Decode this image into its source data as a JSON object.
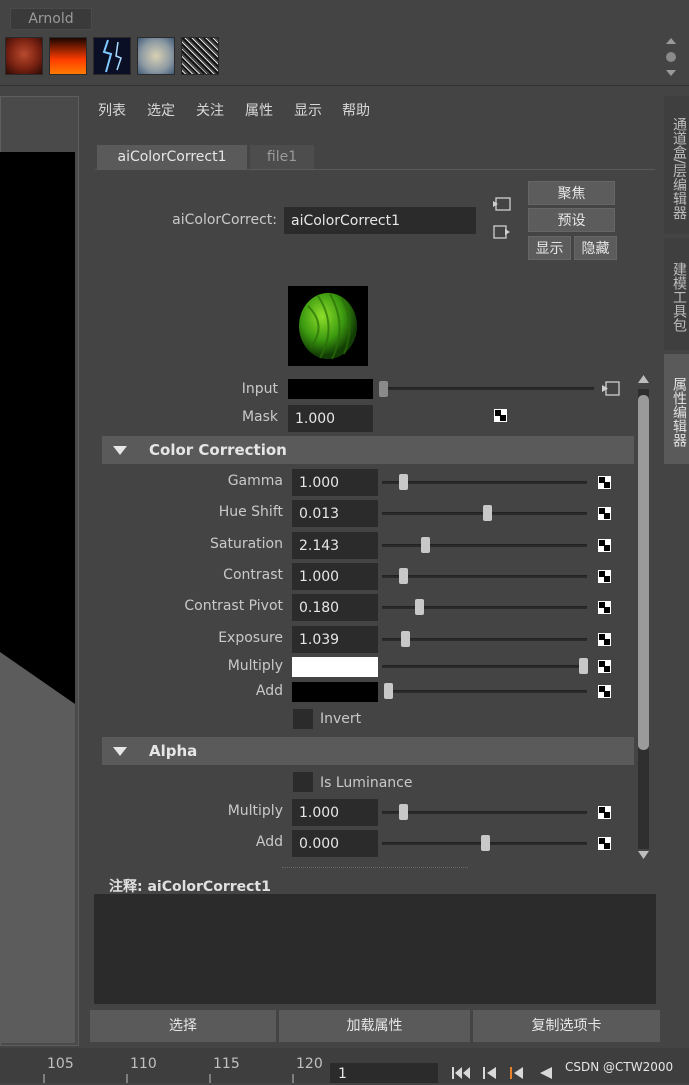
{
  "shelf": {
    "tab": "Arnold",
    "icons": [
      "texture-icon",
      "fire-icon",
      "lightning-icon",
      "cloud-icon",
      "noise-icon"
    ]
  },
  "side_tabs": [
    "通道盒/层编辑器",
    "建模工具包",
    "属性编辑器"
  ],
  "menu": [
    "列表",
    "选定",
    "关注",
    "属性",
    "显示",
    "帮助"
  ],
  "tabs": [
    "aiColorCorrect1",
    "file1"
  ],
  "node": {
    "label": "aiColorCorrect:",
    "value": "aiColorCorrect1",
    "focus": "聚焦",
    "presets": "预设",
    "show": "显示",
    "hide": "隐藏"
  },
  "input": {
    "label": "Input"
  },
  "mask": {
    "label": "Mask",
    "value": "1.000"
  },
  "color_correction": {
    "title": "Color Correction",
    "rows": [
      {
        "label": "Gamma",
        "value": "1.000",
        "slider": 0.1
      },
      {
        "label": "Hue Shift",
        "value": "0.013",
        "slider": 0.51
      },
      {
        "label": "Saturation",
        "value": "2.143",
        "slider": 0.21
      },
      {
        "label": "Contrast",
        "value": "1.000",
        "slider": 0.1
      },
      {
        "label": "Contrast Pivot",
        "value": "0.180",
        "slider": 0.18
      },
      {
        "label": "Exposure",
        "value": "1.039",
        "slider": 0.11
      }
    ],
    "multiply_label": "Multiply",
    "multiply_color": "#ffffff",
    "add_label": "Add",
    "add_color": "#000000",
    "invert_label": "Invert"
  },
  "alpha": {
    "title": "Alpha",
    "is_luminance": "Is Luminance",
    "rows": [
      {
        "label": "Multiply",
        "value": "1.000",
        "slider": 0.1
      },
      {
        "label": "Add",
        "value": "0.000",
        "slider": 0.5
      }
    ]
  },
  "notes": {
    "label": "注释:  aiColorCorrect1"
  },
  "bottom_buttons": [
    "选择",
    "加载属性",
    "复制选项卡"
  ],
  "timeline": {
    "ticks": [
      "105",
      "110",
      "115",
      "120"
    ],
    "current_frame": "1"
  },
  "watermark": "CSDN @CTW2000",
  "colors": {
    "panel": "#444444",
    "field": "#2b2b2b",
    "section": "#5a5a5a"
  }
}
